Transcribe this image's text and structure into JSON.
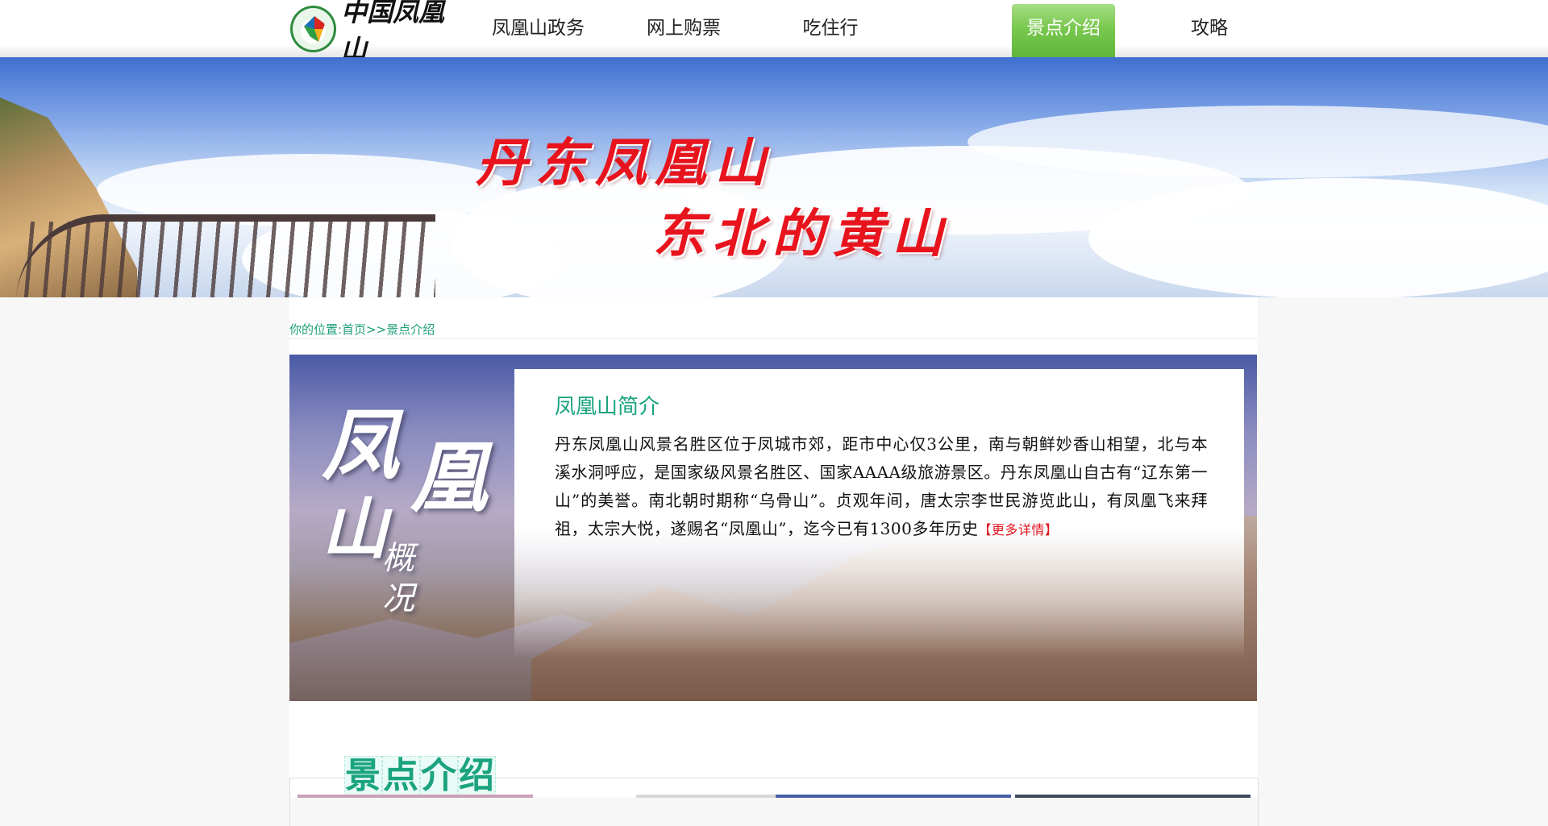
{
  "logo": {
    "text": "中国凤凰山"
  },
  "nav": {
    "items": [
      {
        "label": "凤凰山政务",
        "active": false
      },
      {
        "label": "网上购票",
        "active": false
      },
      {
        "label": "吃住行",
        "active": false
      },
      {
        "label": "景点介绍",
        "active": true
      },
      {
        "label": "攻略",
        "active": false
      }
    ]
  },
  "banner": {
    "line1": "丹东凤凰山",
    "line2": "东北的黄山"
  },
  "breadcrumb": {
    "text": "你的位置:首页>>景点介绍"
  },
  "intro": {
    "calligraphy": [
      "凤",
      "凰",
      "山",
      "概",
      "况"
    ],
    "heading": "凤凰山简介",
    "body": "丹东凤凰山风景名胜区位于凤城市郊，距市中心仅3公里，南与朝鲜妙香山相望，北与本溪水洞呼应，是国家级风景名胜区、国家AAAA级旅游景区。丹东凤凰山自古有“辽东第一山”的美誉。南北朝时期称“乌骨山”。贞观年间，唐太宗李世民游览此山，有凤凰飞来拜祖，太宗大悦，遂赐名“凤凰山”，迄今已有1300多年历史",
    "more_link": "【更多详情】"
  },
  "section": {
    "title_chars": [
      "景",
      "点",
      "介",
      "绍"
    ]
  },
  "colors": {
    "accent_green": "#1aa37f",
    "nav_active": "#79c84f",
    "banner_red": "#e8141d",
    "link_red": "#e0141e"
  }
}
